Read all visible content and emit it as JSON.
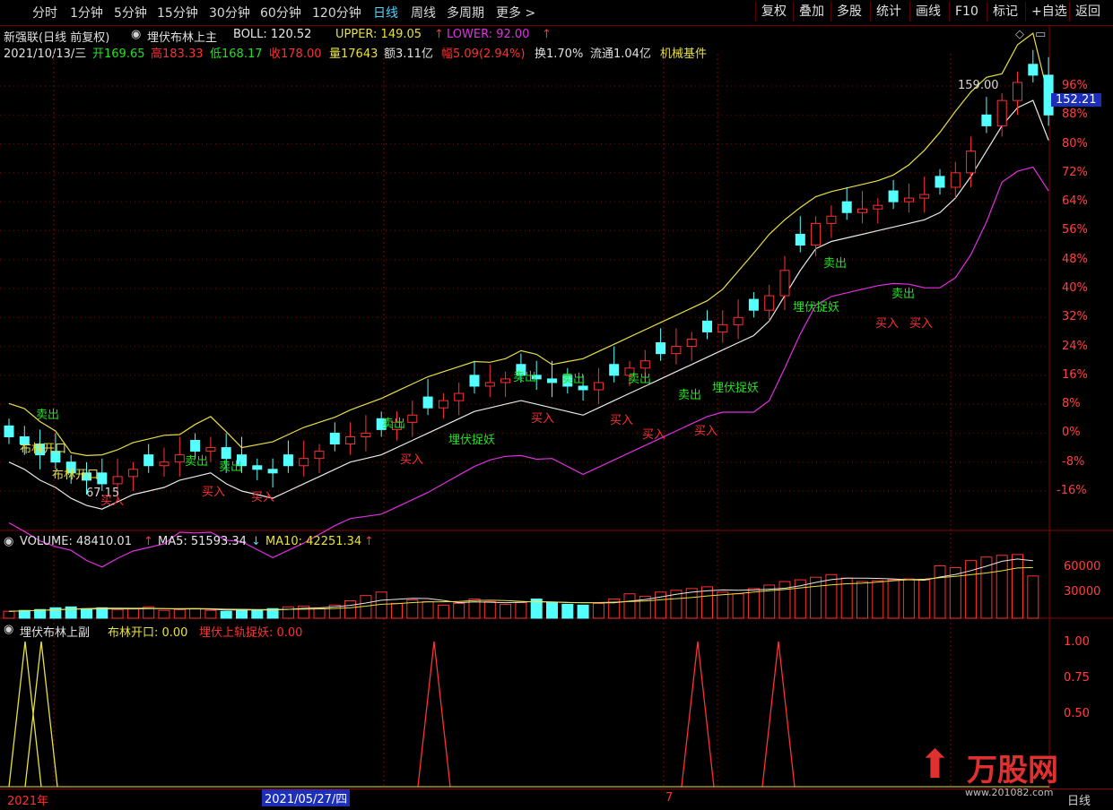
{
  "toolbar": {
    "periods": [
      "分时",
      "1分钟",
      "5分钟",
      "15分钟",
      "30分钟",
      "60分钟",
      "120分钟",
      "日线",
      "周线",
      "多周期",
      "更多 >"
    ],
    "active_period": "日线",
    "right_buttons": [
      "复权",
      "叠加",
      "多股",
      "统计",
      "画线",
      "F10",
      "标记",
      "+自选",
      "返回"
    ]
  },
  "header": {
    "stock_name": "新强联(日线 前复权)",
    "indicator_name": "埋伏布林上主",
    "boll_label": "BOLL: 120.52",
    "upper_label": "UPPER: 149.05",
    "lower_label": "LOWER: 92.00",
    "date": "2021/10/13/三",
    "open": "开169.65",
    "high": "高183.33",
    "low": "低168.17",
    "close": "收178.00",
    "volume": "量17643",
    "amount": "额3.11亿",
    "change": "幅5.09(2.94%)",
    "turnover": "换1.70%",
    "float": "流通1.04亿",
    "industry": "机械基件"
  },
  "main_axis": {
    "ticks": [
      "96%",
      "88%",
      "80%",
      "72%",
      "64%",
      "56%",
      "48%",
      "40%",
      "32%",
      "24%",
      "16%",
      "8%",
      "0%",
      "-8%",
      "-16%"
    ],
    "current_price": "152.21",
    "high_marker": "159.00",
    "low_marker": "67.15"
  },
  "annotations": {
    "sell": "卖出",
    "buy": "买入",
    "boll_open": "布林开口",
    "ambush": "埋伏捉妖"
  },
  "volume_panel": {
    "label": "VOLUME: 48410.01",
    "ma5": "MA5: 51593.34",
    "ma10": "MA10: 42251.34",
    "ticks": [
      "60000",
      "30000"
    ]
  },
  "sub_panel": {
    "name": "埋伏布林上副",
    "boll_open": "布林开口: 0.00",
    "ambush": "埋伏上轨捉妖: 0.00",
    "ticks": [
      "1.00",
      "0.75",
      "0.50"
    ]
  },
  "bottom_axis": {
    "year_label": "2021年",
    "cursor_date": "2021/05/27/四",
    "month_label": "7",
    "period_label": "日线"
  },
  "watermark": {
    "brand": "万股网",
    "url": "www.201082.com"
  },
  "colors": {
    "up": "#ff3030",
    "down": "#54ffff",
    "boll_upper": "#e8e040",
    "boll_mid": "#e8e8e8",
    "boll_lower": "#e030e0",
    "grid": "#8a0000",
    "accent": "#4fd3ff"
  },
  "chart_data": {
    "type": "candlestick",
    "title": "新强联(日线 前复权)",
    "y_axis": "percent change",
    "ylim": [
      -16,
      96
    ],
    "candles_close_pct": [
      -1,
      -3,
      -6,
      -8,
      -11,
      -13,
      -14,
      -12,
      -10,
      -9,
      -8,
      -6,
      -5,
      -4,
      -7,
      -9,
      -10,
      -11,
      -9,
      -7,
      -5,
      -3,
      -1,
      0,
      1,
      3,
      5,
      7,
      9,
      11,
      13,
      14,
      15,
      16,
      15,
      14,
      13,
      12,
      14,
      16,
      18,
      20,
      22,
      24,
      26,
      28,
      30,
      32,
      34,
      38,
      45,
      52,
      58,
      60,
      61,
      62,
      63,
      64,
      65,
      66,
      68,
      72,
      78,
      85,
      92,
      97,
      99,
      88
    ]
  },
  "volume_data": {
    "type": "bar",
    "values": [
      8000,
      9000,
      10000,
      12000,
      13000,
      11000,
      12000,
      10000,
      11000,
      13000,
      9000,
      10000,
      11000,
      9000,
      8000,
      10000,
      9000,
      11000,
      13000,
      14000,
      12000,
      15000,
      20000,
      26000,
      30000,
      17000,
      21000,
      19000,
      15000,
      17000,
      22000,
      19000,
      16000,
      18000,
      22000,
      18000,
      16000,
      15000,
      17000,
      22000,
      28000,
      25000,
      30000,
      32000,
      34000,
      36000,
      30000,
      28000,
      34000,
      38000,
      42000,
      44000,
      47000,
      50000,
      46000,
      42000,
      43000,
      44000,
      45000,
      44000,
      60000,
      58000,
      66000,
      70000,
      72000,
      73000,
      48410
    ]
  },
  "sub_data": {
    "type": "line",
    "spikes_index": [
      1,
      3,
      29,
      48,
      54
    ],
    "values_max": 1.0
  }
}
